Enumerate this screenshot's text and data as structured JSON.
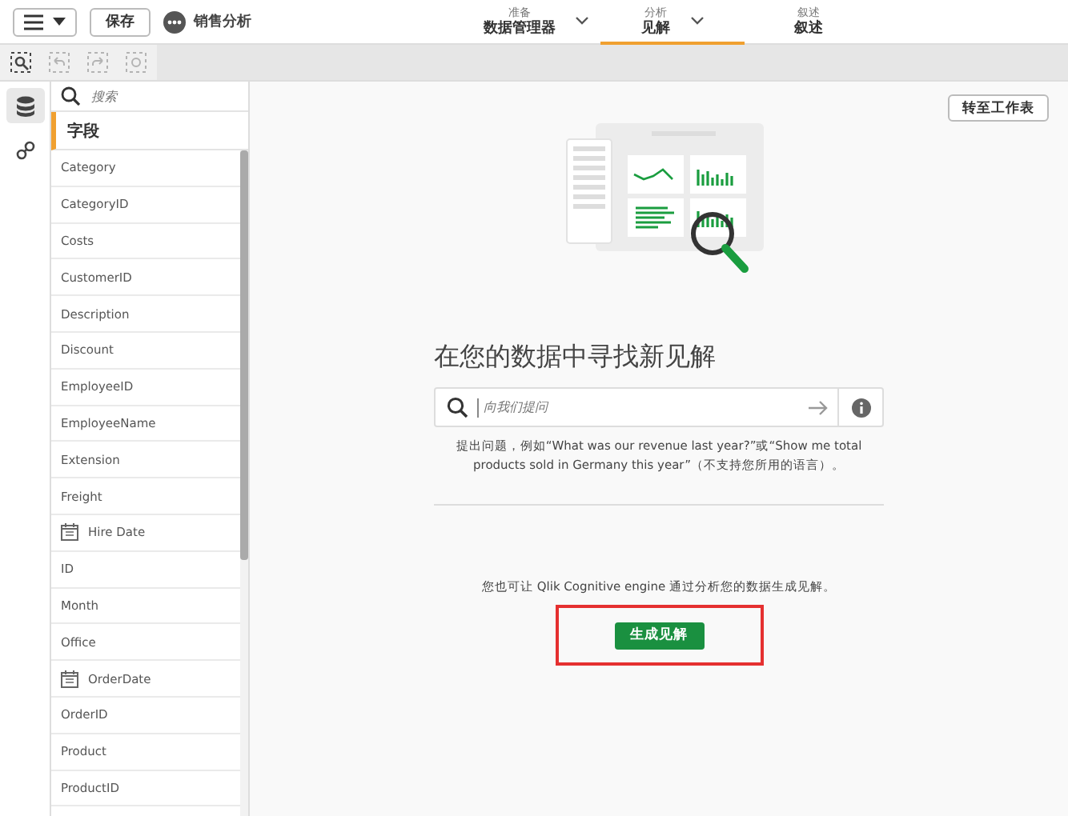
{
  "top_bar": {
    "save_label": "保存",
    "app_name": "销售分析",
    "nav_tabs": [
      {
        "kind": "dropdown",
        "caption": "准备",
        "label": "数据管理器",
        "selected": false
      },
      {
        "kind": "dropdown",
        "caption": "分析",
        "label": "见解",
        "selected": true
      },
      {
        "kind": "plain",
        "caption": "叙述",
        "label": "叙述",
        "selected": false
      }
    ]
  },
  "toolbar": {
    "tools": [
      {
        "disabled": false
      },
      {
        "disabled": true
      },
      {
        "disabled": true
      },
      {
        "disabled": true
      }
    ]
  },
  "sidebar": {
    "rail": [
      {
        "kind": "data",
        "selected": true
      },
      {
        "kind": "link",
        "selected": false
      }
    ],
    "search": {
      "placeholder": "搜索"
    },
    "section_title": "字段",
    "fields": [
      {
        "kind": "plain",
        "name": "Category"
      },
      {
        "kind": "plain",
        "name": "CategoryID"
      },
      {
        "kind": "plain",
        "name": "Costs"
      },
      {
        "kind": "plain",
        "name": "CustomerID"
      },
      {
        "kind": "plain",
        "name": "Description"
      },
      {
        "kind": "plain",
        "name": "Discount"
      },
      {
        "kind": "plain",
        "name": "EmployeeID"
      },
      {
        "kind": "plain",
        "name": "EmployeeName"
      },
      {
        "kind": "plain",
        "name": "Extension"
      },
      {
        "kind": "plain",
        "name": "Freight"
      },
      {
        "kind": "date",
        "name": "Hire Date"
      },
      {
        "kind": "plain",
        "name": "ID"
      },
      {
        "kind": "plain",
        "name": "Month"
      },
      {
        "kind": "plain",
        "name": "Office"
      },
      {
        "kind": "date",
        "name": "OrderDate"
      },
      {
        "kind": "plain",
        "name": "OrderID"
      },
      {
        "kind": "plain",
        "name": "Product"
      },
      {
        "kind": "plain",
        "name": "ProductID"
      }
    ]
  },
  "main": {
    "sheet_button": "转至工作表",
    "heading": "在您的数据中寻找新见解",
    "ask": {
      "placeholder": "向我们提问"
    },
    "hint": "提出问题，例如“What was our revenue last year?”或“Show me total products sold in Germany this year”（不支持您所用的语言）。",
    "note": "您也可让 Qlik Cognitive engine 通过分析您的数据生成见解。",
    "generate_button": {
      "label": "生成见解",
      "highlighted": true
    }
  }
}
